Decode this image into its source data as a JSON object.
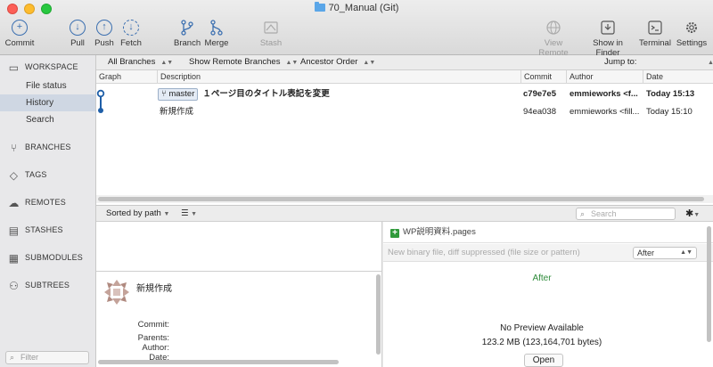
{
  "window": {
    "title": "70_Manual (Git)"
  },
  "toolbar": {
    "commit": "Commit",
    "pull": "Pull",
    "push": "Push",
    "fetch": "Fetch",
    "branch": "Branch",
    "merge": "Merge",
    "stash": "Stash",
    "view_remote": "View Remote",
    "show_in_finder": "Show in Finder",
    "terminal": "Terminal",
    "settings": "Settings"
  },
  "sidebar": {
    "workspace": "WORKSPACE",
    "items": [
      "File status",
      "History",
      "Search"
    ],
    "branches": "BRANCHES",
    "tags": "TAGS",
    "remotes": "REMOTES",
    "stashes": "STASHES",
    "submodules": "SUBMODULES",
    "subtrees": "SUBTREES",
    "filter_placeholder": "Filter"
  },
  "filterbar": {
    "branches": "All Branches",
    "remote": "Show Remote Branches",
    "order": "Ancestor Order",
    "jump_to": "Jump to:"
  },
  "columns": {
    "graph": "Graph",
    "description": "Description",
    "commit": "Commit",
    "author": "Author",
    "date": "Date"
  },
  "commits": [
    {
      "branch": "master",
      "description": "１ページ目のタイトル表記を変更",
      "commit": "c79e7e5",
      "author": "emmieworks <f...",
      "date": "Today 15:13"
    },
    {
      "branch": "",
      "description": "新規作成",
      "commit": "94ea038",
      "author": "emmieworks <fill...",
      "date": "Today 15:10"
    }
  ],
  "sortbar": {
    "sorted_by": "Sorted by path",
    "search_placeholder": "Search"
  },
  "detail": {
    "title": "新規作成",
    "commit_label": "Commit:",
    "parents_label": "Parents:",
    "author_label": "Author:",
    "date_label": "Date:"
  },
  "diff": {
    "file": "WP説明資料.pages",
    "message": "New binary file, diff suppressed (file size or pattern)",
    "view_select": "After",
    "after_label": "After",
    "no_preview": "No Preview Available",
    "size": "123.2 MB (123,164,701 bytes)",
    "open_button": "Open"
  },
  "colors": {
    "graph": "#1f5fa8",
    "accent": "#3b6fb0",
    "added": "#2f9a3a"
  }
}
